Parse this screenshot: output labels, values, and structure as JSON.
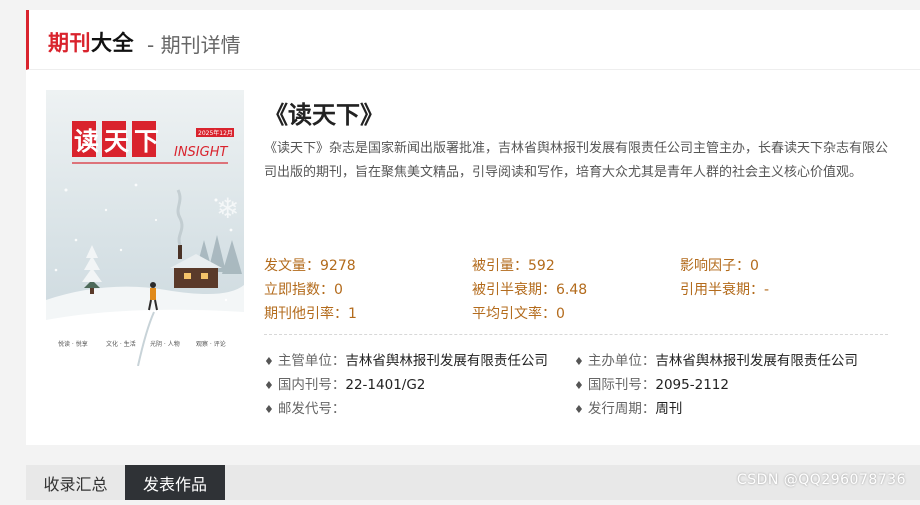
{
  "header": {
    "brand_red": "期刊",
    "brand_black": "大全",
    "subtitle": "- 期刊详情"
  },
  "cover": {
    "masthead": "读天下",
    "english": "INSIGHT",
    "issue": "2025年12月",
    "tagline_left": "悦读 · 悦享",
    "tagline_right": "文化 · 生活",
    "theme": "snowy-cabin-illustration"
  },
  "journal": {
    "title": "《读天下》",
    "description": "《读天下》杂志是国家新闻出版署批准，吉林省舆林报刊发展有限责任公司主管主办，长春读天下杂志有限公司出版的期刊，旨在聚焦美文精品，引导阅读和写作，培育大众尤其是青年人群的社会主义核心价值观。"
  },
  "metrics": [
    {
      "label": "发文量：",
      "value": "9278"
    },
    {
      "label": "被引量：",
      "value": "592"
    },
    {
      "label": "影响因子：",
      "value": "0"
    },
    {
      "label": "立即指数：",
      "value": "0"
    },
    {
      "label": "被引半衰期：",
      "value": "6.48"
    },
    {
      "label": "引用半衰期：",
      "value": "-"
    },
    {
      "label": "期刊他引率：",
      "value": "1"
    },
    {
      "label": "平均引文率：",
      "value": "0"
    }
  ],
  "info": [
    {
      "label": "主管单位：",
      "value": "吉林省舆林报刊发展有限责任公司"
    },
    {
      "label": "主办单位：",
      "value": "吉林省舆林报刊发展有限责任公司"
    },
    {
      "label": "国内刊号：",
      "value": "22-1401/G2"
    },
    {
      "label": "国际刊号：",
      "value": "2095-2112"
    },
    {
      "label": "邮发代号：",
      "value": ""
    },
    {
      "label": "发行周期：",
      "value": "周刊"
    }
  ],
  "bullet_glyph": "♦",
  "tabs": [
    {
      "label": "收录汇总",
      "active": false
    },
    {
      "label": "发表作品",
      "active": true
    }
  ],
  "watermark": "CSDN @QQ296078736",
  "colors": {
    "brand_red": "#d9232d",
    "metric_orange": "#b36b1c",
    "active_tab": "#2f3236"
  }
}
